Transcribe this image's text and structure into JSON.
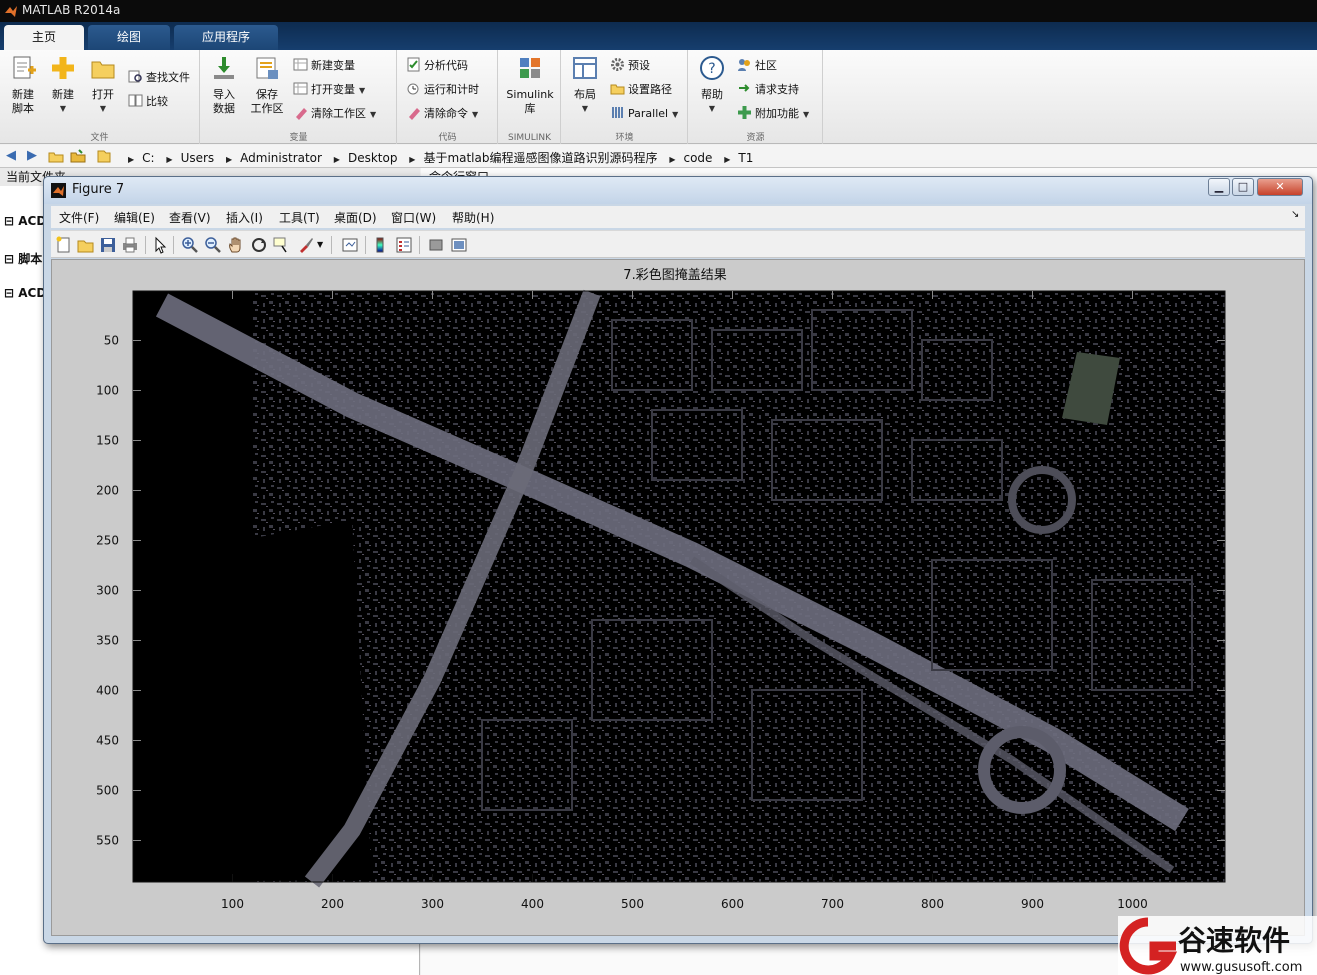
{
  "app": {
    "title": "MATLAB R2014a"
  },
  "ribbon": {
    "tabs": [
      {
        "label": "主页"
      },
      {
        "label": "绘图"
      },
      {
        "label": "应用程序"
      }
    ],
    "file": {
      "label": "文件",
      "new_script": "新建\n脚本",
      "new": "新建",
      "open": "打开",
      "find_files": "查找文件",
      "compare": "比较"
    },
    "variable": {
      "label": "变量",
      "import": "导入\n数据",
      "save": "保存\n工作区",
      "new_var": "新建变量",
      "open_var": "打开变量",
      "clear_ws": "清除工作区"
    },
    "code": {
      "label": "代码",
      "analyze": "分析代码",
      "run_time": "运行和计时",
      "clear_cmd": "清除命令"
    },
    "simulink": {
      "label": "SIMULINK",
      "lib": "Simulink\n库"
    },
    "environment": {
      "label": "环境",
      "layout": "布局",
      "prefs": "预设",
      "set_path": "设置路径",
      "parallel": "Parallel"
    },
    "resources": {
      "label": "资源",
      "help": "帮助",
      "community": "社区",
      "support": "请求支持",
      "addons": "附加功能"
    }
  },
  "address": {
    "segments": [
      "C:",
      "Users",
      "Administrator",
      "Desktop",
      "基于matlab编程遥感图像道路识别源码程序",
      "code",
      "T1"
    ]
  },
  "background": {
    "left_header": "当前文件夹",
    "right_header": "命令行窗口",
    "tree": [
      "ACD",
      "脚本",
      "ACD"
    ]
  },
  "figure": {
    "title": "Figure 7",
    "menu": [
      "文件(F)",
      "编辑(E)",
      "查看(V)",
      "插入(I)",
      "工具(T)",
      "桌面(D)",
      "窗口(W)",
      "帮助(H)"
    ],
    "toolbar": [
      "new-figure-icon",
      "open-file-icon",
      "save-icon",
      "print-icon",
      "pointer-icon",
      "zoom-in-icon",
      "zoom-out-icon",
      "pan-icon",
      "rotate-3d-icon",
      "data-cursor-icon",
      "brush-icon",
      "link-plot-icon",
      "colorbar-icon",
      "legend-icon",
      "hide-plot-tools-icon",
      "show-plot-tools-icon"
    ]
  },
  "chart_data": {
    "type": "heatmap",
    "title": "7.彩色图掩盖结果",
    "xlabel": "",
    "ylabel": "",
    "x_ticks": [
      100,
      200,
      300,
      400,
      500,
      600,
      700,
      800,
      900,
      1000
    ],
    "y_ticks": [
      50,
      100,
      150,
      200,
      250,
      300,
      350,
      400,
      450,
      500,
      550
    ],
    "xlim": [
      0.5,
      1092.5
    ],
    "ylim": [
      0.5,
      591.5
    ],
    "y_direction": "reverse",
    "content": "masked aerial road image"
  },
  "watermark": {
    "brand": "谷速软件",
    "url": "www.gususoft.com"
  },
  "colors": {
    "ribbon_dark": "#0d2b4f",
    "figure_frame": "#c9d7e6",
    "axes_bg": "#000000"
  }
}
